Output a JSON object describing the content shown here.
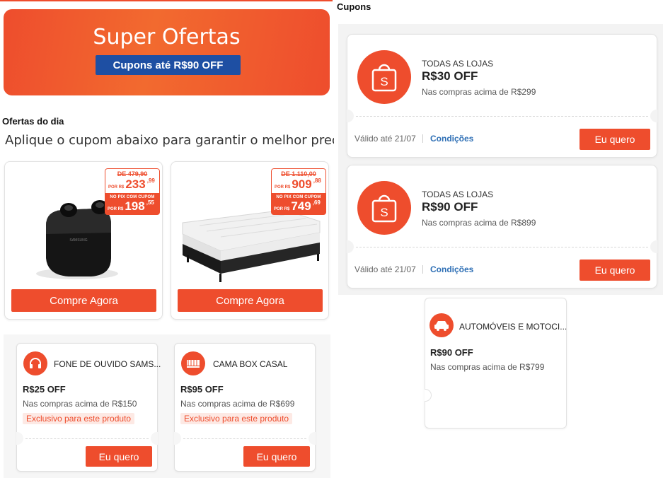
{
  "banner": {
    "title": "Super Ofertas",
    "pill": "Cupons até R$90 OFF"
  },
  "daily": {
    "section_label": "Ofertas do dia",
    "headline": "Aplique o cupom abaixo para garantir o melhor preço"
  },
  "products": [
    {
      "image_icon": "earbuds-case-image",
      "price_was": "DE 479,90",
      "price_por": "POR R$",
      "price": "233",
      "price_cents": ",99",
      "pix_label": "NO PIX COM CUPOM",
      "pix_por": "POR R$",
      "pix_price": "198",
      "pix_cents": ",55",
      "button": "Compre Agora"
    },
    {
      "image_icon": "box-bed-mattress-image",
      "price_was": "DE 1.110,00",
      "price_por": "POR R$",
      "price": "909",
      "price_cents": ",88",
      "pix_label": "NO PIX COM CUPOM",
      "pix_por": "POR R$",
      "pix_price": "749",
      "pix_cents": ",69",
      "button": "Compre Agora"
    }
  ],
  "product_coupons": [
    {
      "icon": "headphones-icon",
      "name": "FONE DE OUVIDO SAMS...",
      "value": "R$25 OFF",
      "condition": "Nas compras acima de R$150",
      "exclusive": "Exclusivo para este produto",
      "button": "Eu quero"
    },
    {
      "icon": "bed-icon",
      "name": "CAMA BOX CASAL",
      "value": "R$95 OFF",
      "condition": "Nas compras acima de R$699",
      "exclusive": "Exclusivo para este produto",
      "button": "Eu quero"
    }
  ],
  "cupons": {
    "title": "Cupons",
    "items": [
      {
        "icon": "shopping-bag-icon",
        "scope": "TODAS AS LOJAS",
        "value": "R$30 OFF",
        "condition": "Nas compras acima de R$299",
        "valid": "Válido até 21/07",
        "conditions_link": "Condições",
        "button": "Eu quero"
      },
      {
        "icon": "shopping-bag-icon",
        "scope": "TODAS AS LOJAS",
        "value": "R$90 OFF",
        "condition": "Nas compras acima de R$899",
        "valid": "Válido até 21/07",
        "conditions_link": "Condições",
        "button": "Eu quero"
      }
    ],
    "auto": {
      "icon": "car-icon",
      "name": "AUTOMÓVEIS E MOTOCI...",
      "value": "R$90 OFF",
      "condition": "Nas compras acima de R$799"
    }
  },
  "colors": {
    "accent": "#ee4d2d",
    "banner_pill": "#1e4fa3",
    "link": "#2e6fb5"
  }
}
